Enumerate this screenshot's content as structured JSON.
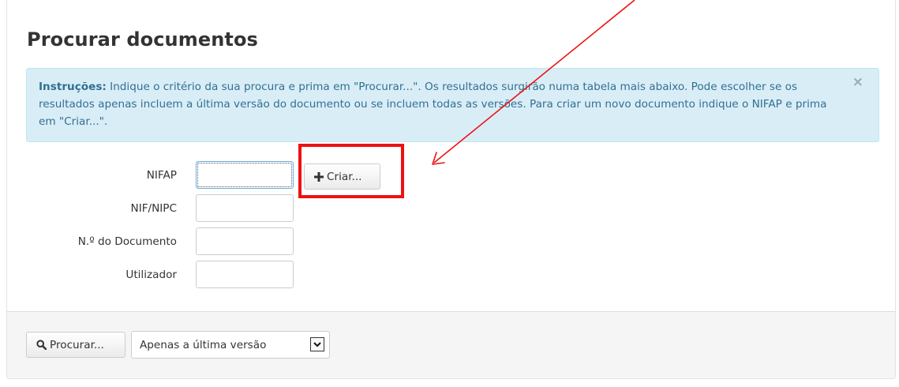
{
  "page": {
    "title": "Procurar documentos"
  },
  "alert": {
    "label": "Instruções:",
    "text": " Indique o critério da sua procura e prima em \"Procurar...\". Os resultados surgirão numa tabela mais abaixo. Pode escolher se os resultados apenas incluem a última versão do documento ou se incluem todas as versões. Para criar um novo documento indique o NIFAP e prima em \"Criar...\".",
    "close_symbol": "×"
  },
  "form": {
    "fields": [
      {
        "label": "NIFAP",
        "value": ""
      },
      {
        "label": "NIF/NIPC",
        "value": ""
      },
      {
        "label": "N.º do Documento",
        "value": ""
      },
      {
        "label": "Utilizador",
        "value": ""
      }
    ],
    "create_button": {
      "label": "Criar...",
      "icon": "plus-icon"
    }
  },
  "footer": {
    "search_button": {
      "label": "Procurar...",
      "icon": "search-icon"
    },
    "version_select": {
      "selected": "Apenas a última versão",
      "icon": "chevron-down-icon"
    }
  },
  "colors": {
    "alert_bg": "#d9edf7",
    "alert_text": "#31708f",
    "annotation": "#ee1111"
  }
}
